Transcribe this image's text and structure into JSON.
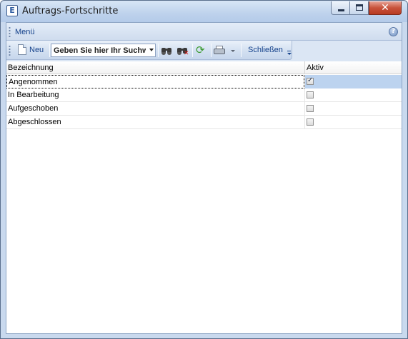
{
  "window": {
    "title": "Auftrags-Fortschritte",
    "app_icon_letter": "E",
    "controls": {
      "minimize": "minimize",
      "maximize": "maximize",
      "close": "✕"
    }
  },
  "menubar": {
    "label": "Menü",
    "help_icon": "?"
  },
  "toolbar": {
    "new_label": "Neu",
    "search_placeholder": "Geben Sie hier Ihr Suchw",
    "close_label": "Schließen",
    "icons": [
      "new-document-icon",
      "binoculars-icon",
      "binoculars-clear-icon",
      "refresh-icon",
      "printer-icon",
      "overflow-chevron-icon"
    ]
  },
  "grid": {
    "columns": [
      "Bezeichnung",
      "Aktiv"
    ],
    "rows": [
      {
        "name": "Angenommen",
        "aktiv": true
      },
      {
        "name": "In Bearbeitung",
        "aktiv": false
      },
      {
        "name": "Aufgeschoben",
        "aktiv": false
      },
      {
        "name": "Abgeschlossen",
        "aktiv": false
      }
    ],
    "selected_row": 0
  },
  "colors": {
    "frame": "#c9d9ee",
    "accent_text": "#15428b",
    "selection": "#cfe0f5",
    "close_button": "#c8523b"
  }
}
